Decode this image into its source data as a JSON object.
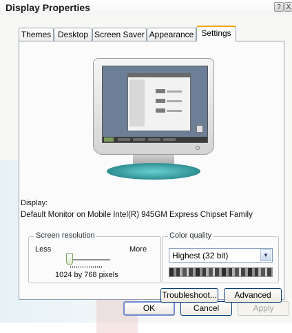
{
  "window": {
    "title": "Display Properties",
    "help_symbol": "?",
    "close_symbol": "X"
  },
  "tabs": [
    {
      "label": "Themes"
    },
    {
      "label": "Desktop"
    },
    {
      "label": "Screen Saver"
    },
    {
      "label": "Appearance"
    },
    {
      "label": "Settings",
      "active": true
    }
  ],
  "display": {
    "label": "Display:",
    "device": "Default Monitor on Mobile Intel(R) 945GM Express Chipset Family"
  },
  "screen_resolution": {
    "legend": "Screen resolution",
    "less_label": "Less",
    "more_label": "More",
    "value": "1024 by 768 pixels",
    "slider_level": 0.0
  },
  "color_quality": {
    "legend": "Color quality",
    "selected": "Highest (32 bit)"
  },
  "buttons": {
    "troubleshoot": "Troubleshoot...",
    "advanced": "Advanced",
    "ok": "OK",
    "cancel": "Cancel",
    "apply": "Apply"
  },
  "colors": {
    "active_tab_accent": "#f6a400",
    "button_border": "#003c74",
    "monitor_base": "#2f8f94"
  }
}
